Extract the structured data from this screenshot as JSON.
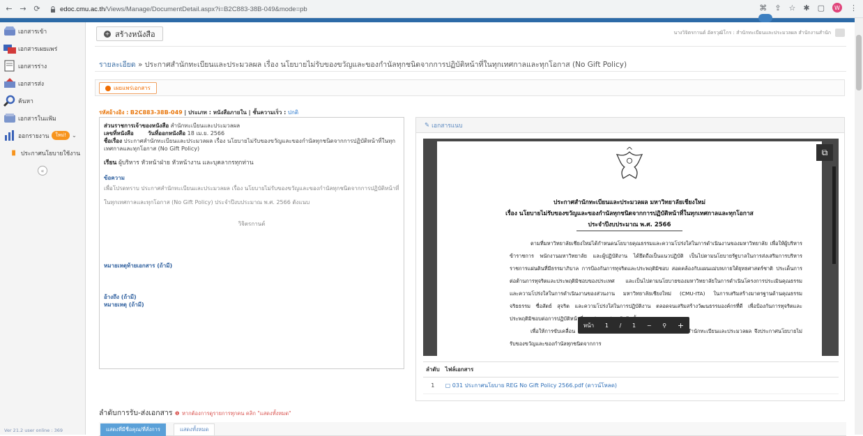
{
  "browser": {
    "url_host": "edoc.cmu.ac.th",
    "url_path": "/Views/Manage/DocumentDetail.aspx?i=B2C883-38B-049&mode=pb",
    "profile_initial": "W"
  },
  "sidebar": {
    "items": [
      {
        "label": "เอกสารเข้า",
        "icon": "inbox-icon"
      },
      {
        "label": "เอกสารเผยแพร่",
        "icon": "broadcast-icon"
      },
      {
        "label": "เอกสารร่าง",
        "icon": "draft-icon"
      },
      {
        "label": "เอกสารส่ง",
        "icon": "send-icon"
      },
      {
        "label": "ค้นหา",
        "icon": "search-icon"
      },
      {
        "label": "เอกสารในแฟ้ม",
        "icon": "folder-icon"
      },
      {
        "label": "ออกรายงาน",
        "icon": "report-icon",
        "badge": "ใหม่!"
      },
      {
        "label": "ประกาศนโยบายใช้งาน",
        "icon": "policy-icon"
      }
    ],
    "version": "Ver 21.2 user online : 369"
  },
  "header": {
    "create_label": "สร้างหนังสือ",
    "user_text": "นางวิจิตรกานต์ อัครวุฒิโกร : สำนักทะเบียนและประมวลผล สำนักงานสำนัก"
  },
  "breadcrumb": {
    "link": "รายละเอียด",
    "sep": "»",
    "title": "ประกาศสำนักทะเบียนและประมวลผล เรื่อง นโยบายไม่รับของขวัญและของกำนัลทุกชนิดจากการปฏิบัติหน้าที่ในทุกเทศกาลและทุกโอกาส (No Gift Policy)"
  },
  "publish_button": "เผยแพร่เอกสาร",
  "meta": {
    "ref_label": "รหัสอ้างอิง :",
    "ref_code": "B2C883-38B-049",
    "type_text": "| ประเภท : หนังสือภายใน | ชั้นความเร็ว :",
    "urgency": "ปกติ"
  },
  "detail": {
    "owner_label": "ส่วนราชการเจ้าของหนังสือ",
    "owner_value": "สำนักทะเบียนและประมวลผล",
    "docno_label": "เลขที่หนังสือ",
    "date_label": "วันที่ออกหนังสือ",
    "date_value": "18 เม.ย. 2566",
    "subject_label": "ชื่อเรื่อง",
    "subject_value": "ประกาศสำนักทะเบียนและประมวลผล เรื่อง นโยบายไม่รับของขวัญและของกำนัลทุกชนิดจากการปฏิบัติหน้าที่ในทุกเทศกาลและทุกโอกาส (No Gift Policy)",
    "to_label": "เรียน",
    "to_value": "ผู้บริหาร หัวหน้าฝ่าย หัวหน้างาน และบุคลากรทุกท่าน",
    "message_label": "ข้อความ",
    "message_value": "เพื่อโปรดทราบ ประกาศสำนักทะเบียนและประมวลผล เรื่อง นโยบายไม่รับของขวัญและของกำนัลทุกชนิดจากการปฏิบัติหน้าที่ในทุกเทศกาลและทุกโอกาส (No Gift Policy) ประจำปีงบประมาณ พ.ศ. 2566 ดังแนบ",
    "signer": "วิจิตรกานต์",
    "footnote_label": "หมายเหตุท้ายเอกสาร (ถ้ามี)",
    "ref_label": "อ้างถึง (ถ้ามี)",
    "remark_label": "หมายเหตุ (ถ้ามี)"
  },
  "attachment": {
    "header": "เอกสารแนบ",
    "doc_title_1": "ประกาศสำนักทะเบียนและประมวลผล มหาวิทยาลัยเชียงใหม่",
    "doc_title_2": "เรื่อง นโยบายไม่รับของขวัญและของกำนัลทุกชนิดจากการปฏิบัติหน้าที่ในทุกเทศกาลและทุกโอกาส",
    "doc_title_3": "ประจำปีงบประมาณ พ.ศ. 2566",
    "doc_para_1": "ตามที่มหาวิทยาลัยเชียงใหม่ได้กำหนดนโยบายคุณธรรมและความโปร่งใสในการดำเนินงานของมหาวิทยาลัย เพื่อให้ผู้บริหาร ข้าราชการ พนักงานมหาวิทยาลัย และผู้ปฏิบัติงาน ได้ยึดถือเป็นแนวปฏิบัติ เป็นไปตามนโยบายรัฐบาลในการส่งเสริมการบริหารราชการแผ่นดินที่มีธรรมาภิบาล การป้องกันการทุจริตและประพฤติมิชอบ สอดคล้องกับแผนแม่บทภายใต้ยุทธศาสตร์ชาติ ประเด็นการต่อต้านการทุจริตและประพฤติมิชอบของประเทศ และเป็นไปตามนโยบายของมหาวิทยาลัยในการดำเนินโครงการประเมินคุณธรรมและความโปร่งใสในการดำเนินงานของส่วนงาน มหาวิทยาลัยเชียงใหม่ (CMU-ITA) ในการเสริมสร้างมาตรฐานด้านคุณธรรม จริยธรรม ซื่อสัตย์ สุจริต และความโปร่งใสในการปฏิบัติงาน ตลอดจนเสริมสร้างวัฒนธรรมองค์กรที่ดี เพื่อป้องกันการทุจริตและประพฤติมิชอบต่อการปฏิบัติหน้าที่ทุกรูปแบบอย่างจริงจัง นั้น",
    "doc_para_2": "เพื่อให้การขับเคลื่อน มหาวิทยาลัยเป็นไปอย่างต่อเนื่อง และเกิดบรรทม สำนักทะเบียนและประมวลผล จึงประกาศนโยบายไม่รับของขวัญและของกำนัลทุกชนิดจากการ",
    "toolbar": {
      "page_label": "หน้า",
      "page_num": "1",
      "sep": "/",
      "page_total": "1"
    },
    "table_headers": [
      "ลำดับ",
      "ไฟล์เอกสาร"
    ],
    "files": [
      {
        "no": "1",
        "name": "031 ประกาศนโยบาย REG No Gift Policy 2566.pdf",
        "download": "(ดาวน์โหลด)"
      }
    ]
  },
  "flow": {
    "title": "ลำดับการรับ-ส่งเอกสาร",
    "warn": "หากต้องการดูรายการทุกคน คลิก \"แสดงทั้งหมด\"",
    "tab_active": "แสดงที่มีชื่อคุณ/ที่สั่งการ",
    "tab_all": "แสดงทั้งหมด"
  }
}
